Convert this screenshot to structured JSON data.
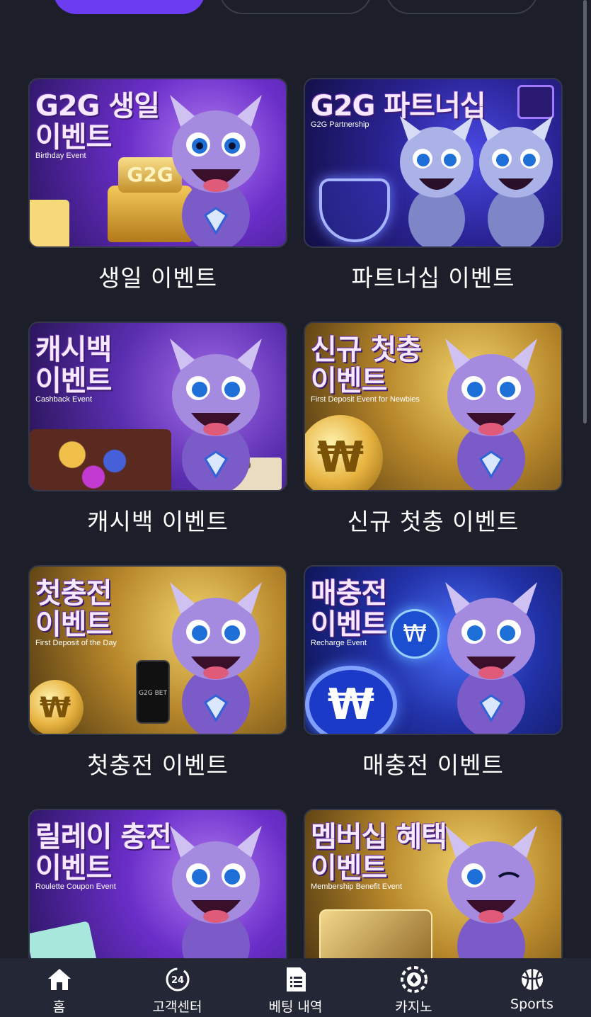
{
  "events": [
    {
      "title_ko": "G2G 생일\n이벤트",
      "subtitle_en": "Birthday Event",
      "caption": "생일 이벤트",
      "theme": "#6a2ec9"
    },
    {
      "title_ko": "G2G 파트너십",
      "subtitle_en": "G2G Partnership",
      "caption": "파트너십 이벤트",
      "theme": "#2a2394"
    },
    {
      "title_ko": "캐시백\n이벤트",
      "subtitle_en": "Cashback Event",
      "caption": "캐시백 이벤트",
      "theme": "#5a2eb0"
    },
    {
      "title_ko": "신규 첫충\n이벤트",
      "subtitle_en": "First Deposit Event for Newbies",
      "caption": "신규 첫충 이벤트",
      "theme": "#b6862a"
    },
    {
      "title_ko": "첫충전\n이벤트",
      "subtitle_en": "First Deposit of the Day",
      "caption": "첫충전 이벤트",
      "theme": "#b6862a"
    },
    {
      "title_ko": "매충전\n이벤트",
      "subtitle_en": "Recharge Event",
      "caption": "매충전 이벤트",
      "theme": "#2232a8"
    },
    {
      "title_ko": "릴레이 충전\n이벤트",
      "subtitle_en": "Roulette Coupon Event",
      "caption": "",
      "theme": "#6a2ec9"
    },
    {
      "title_ko": "멤버십 혜택\n이벤트",
      "subtitle_en": "Membership Benefit Event",
      "caption": "",
      "theme": "#b6862a"
    }
  ],
  "bottom_nav": [
    {
      "label": "홈",
      "icon": "home-icon"
    },
    {
      "label": "고객센터",
      "icon": "support-24-icon"
    },
    {
      "label": "베팅 내역",
      "icon": "document-list-icon"
    },
    {
      "label": "카지노",
      "icon": "casino-chip-icon"
    },
    {
      "label": "Sports",
      "icon": "sports-ball-icon"
    }
  ],
  "colors": {
    "background": "#1c1e29",
    "accent": "#6c3cf0",
    "nav_bg": "#242736"
  }
}
